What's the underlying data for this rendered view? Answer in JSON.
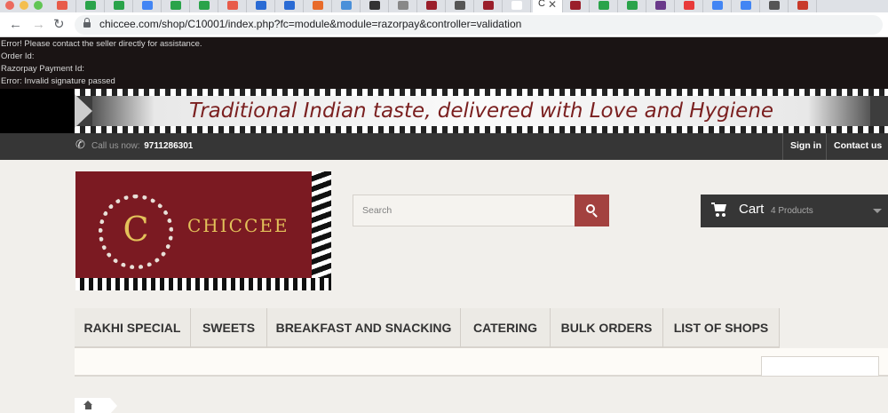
{
  "browser": {
    "url": "chiccee.com/shop/C10001/index.php?fc=module&module=razorpay&controller=validation",
    "tab_favicon_colors": [
      "#e85c4a",
      "#2aa34a",
      "#2aa34a",
      "#4285f4",
      "#2aa34a",
      "#2aa34a",
      "#e85c4a",
      "#2a6bd4",
      "#2a6bd4",
      "#e86b2a",
      "#4a90d9",
      "#333333",
      "#888888",
      "#9a1f2b",
      "#555555",
      "#9a1f2b",
      "#ffffff",
      "#9a1f2b",
      "#2aa34a",
      "#2aa34a",
      "#6a3a8a",
      "#e83a3a",
      "#4285f4",
      "#4285f4",
      "#555555",
      "#c83a2a"
    ],
    "active_tab_close": "✕",
    "active_tab_label": "C"
  },
  "error": {
    "lines": [
      "Error! Please contact the seller directly for assistance.",
      "Order Id:",
      "Razorpay Payment Id:",
      "Error: Invalid signature passed"
    ]
  },
  "banner": {
    "text": "Traditional Indian taste, delivered with Love and Hygiene"
  },
  "topnav": {
    "call_label": "Call us now:",
    "phone": "9711286301",
    "signin": "Sign in",
    "contact": "Contact us"
  },
  "logo": {
    "initial": "C",
    "name": "CHICCEE",
    "brand_color": "#7b1a22",
    "gold": "#e3c25a"
  },
  "search": {
    "placeholder": "Search",
    "button_color": "#a3413f"
  },
  "cart": {
    "label": "Cart",
    "count": "4 Products"
  },
  "menu": {
    "items": [
      "RAKHI SPECIAL",
      "SWEETS",
      "BREAKFAST AND SNACKING",
      "CATERING",
      "BULK ORDERS",
      "LIST OF SHOPS"
    ]
  },
  "icons": {
    "phone": "phone-icon",
    "search": "search-icon",
    "cart": "cart-icon",
    "home": "home-icon",
    "lock": "lock-icon"
  }
}
